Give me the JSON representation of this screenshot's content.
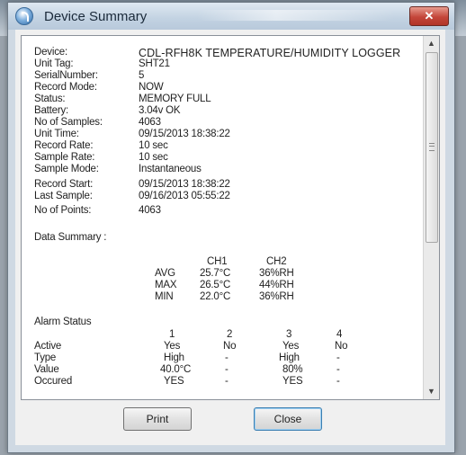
{
  "window": {
    "title": "Device Summary",
    "close_glyph": "✕"
  },
  "report": {
    "fields": [
      {
        "label": "Device:",
        "value": "CDL-RFH8K  TEMPERATURE/HUMIDITY LOGGER"
      },
      {
        "label": "Unit Tag:",
        "value": "SHT21"
      },
      {
        "label": "SerialNumber:",
        "value": "5"
      },
      {
        "label": "Record Mode:",
        "value": "NOW"
      },
      {
        "label": "Status:",
        "value": "MEMORY FULL"
      },
      {
        "label": "Battery:",
        "value": "3.04v OK"
      },
      {
        "label": "No of  Samples:",
        "value": "4063"
      },
      {
        "label": "Unit Time:",
        "value": "09/15/2013 18:38:22"
      },
      {
        "label": "Record Rate:",
        "value": "10 sec"
      },
      {
        "label": "Sample Rate:",
        "value": "10 sec"
      },
      {
        "label": "Sample Mode:",
        "value": "Instantaneous"
      },
      {
        "label": "Record Start:",
        "value": "09/15/2013 18:38:22"
      },
      {
        "label": "Last Sample:",
        "value": "09/16/2013 05:55:22"
      },
      {
        "label": "No  of  Points:",
        "value": "4063"
      }
    ],
    "data_summary": {
      "heading": "Data Summary :",
      "channels": [
        "CH1",
        "CH2"
      ],
      "rows": [
        {
          "label": "AVG",
          "ch1": "25.7°C",
          "ch2": "36%RH"
        },
        {
          "label": "MAX",
          "ch1": "26.5°C",
          "ch2": "44%RH"
        },
        {
          "label": "MIN",
          "ch1": "22.0°C",
          "ch2": "36%RH"
        }
      ]
    },
    "alarm_status": {
      "heading": "Alarm Status",
      "columns": [
        "1",
        "2",
        "3",
        "4"
      ],
      "rows": [
        {
          "label": "Active",
          "values": [
            "Yes",
            "No",
            "Yes",
            "No"
          ]
        },
        {
          "label": "Type",
          "values": [
            "High",
            "-",
            "High",
            "-"
          ]
        },
        {
          "label": "Value",
          "values": [
            "40.0°C",
            "-",
            "80%",
            "-"
          ]
        },
        {
          "label": "Occured",
          "values": [
            "YES",
            "-",
            "YES",
            "-"
          ]
        }
      ]
    }
  },
  "scrollbar": {
    "up_glyph": "▲",
    "down_glyph": "▼"
  },
  "buttons": {
    "print_label": "Print",
    "close_label": "Close"
  }
}
